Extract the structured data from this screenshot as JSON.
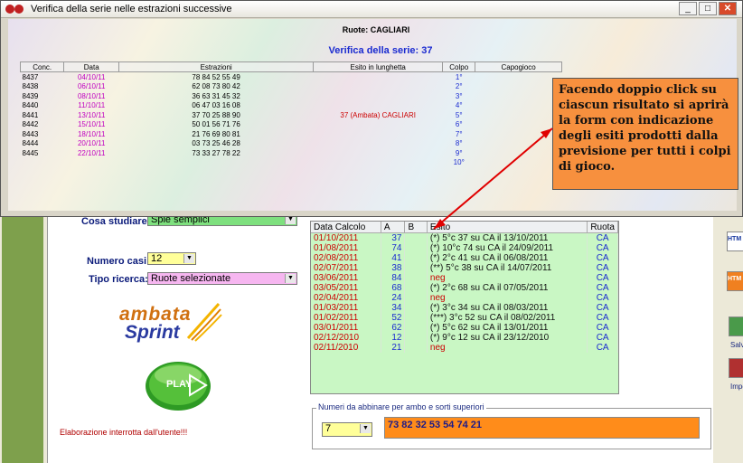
{
  "dialog": {
    "title": "Verifica della serie nelle estrazioni successive",
    "ruote": "Ruote: CAGLIARI",
    "verifica": "Verifica della serie: 37",
    "columns": [
      "Conc.",
      "Data",
      "Estrazioni",
      "Esito in lunghetta",
      "Colpo",
      "Capogioco"
    ],
    "rows": [
      {
        "conc": "8437",
        "data": "04/10/11",
        "estr": "78 84 52 55 49",
        "esito": "",
        "colpo": "1°"
      },
      {
        "conc": "8438",
        "data": "06/10/11",
        "estr": "62 08 73 80 42",
        "esito": "",
        "colpo": "2°"
      },
      {
        "conc": "8439",
        "data": "08/10/11",
        "estr": "36 63 31 45 32",
        "esito": "",
        "colpo": "3°"
      },
      {
        "conc": "8440",
        "data": "11/10/11",
        "estr": "06 47 03 16 08",
        "esito": "",
        "colpo": "4°"
      },
      {
        "conc": "8441",
        "data": "13/10/11",
        "estr": "37 70 25 88 90",
        "esito": "37   (Ambata) CAGLIARI",
        "colpo": "5°"
      },
      {
        "conc": "8442",
        "data": "15/10/11",
        "estr": "50 01 56 71 76",
        "esito": "",
        "colpo": "6°"
      },
      {
        "conc": "8443",
        "data": "18/10/11",
        "estr": "21 76 69 80 81",
        "esito": "",
        "colpo": "7°"
      },
      {
        "conc": "8444",
        "data": "20/10/11",
        "estr": "03 73 25 46 28",
        "esito": "",
        "colpo": "8°"
      },
      {
        "conc": "8445",
        "data": "22/10/11",
        "estr": "73 33 27 78 22",
        "esito": "",
        "colpo": "9°"
      },
      {
        "conc": "",
        "data": "",
        "estr": "",
        "esito": "",
        "colpo": "10°"
      }
    ]
  },
  "callout": "Facendo doppio click su ciascun risultato si aprirà la form con indicazione degli esiti prodotti dalla previsione per tutti i colpi di gioco.",
  "form": {
    "cosa_label": "Cosa studiare:",
    "cosa_value": "Spie semplici",
    "numero_label": "Numero casi:",
    "numero_value": "12",
    "tipo_label": "Tipo ricerca:",
    "tipo_value": "Ruote selezionate",
    "logo_line1": "ambata",
    "logo_line2": "Sprint",
    "play_label": "PLAY",
    "status": "Elaborazione interrotta dall'utente!!!"
  },
  "grid": {
    "columns": [
      "Data Calcolo",
      "A",
      "B",
      "Esito",
      "Ruota"
    ],
    "rows": [
      {
        "data": "01/10/2011",
        "a": "37",
        "b": "",
        "esito": "(*) 5°c 37 su CA il 13/10/2011",
        "ruota": "CA",
        "neg": false
      },
      {
        "data": "01/08/2011",
        "a": "74",
        "b": "",
        "esito": "(*) 10°c 74 su CA il 24/09/2011",
        "ruota": "CA",
        "neg": false
      },
      {
        "data": "02/08/2011",
        "a": "41",
        "b": "",
        "esito": "(*) 2°c 41 su CA il 06/08/2011",
        "ruota": "CA",
        "neg": false
      },
      {
        "data": "02/07/2011",
        "a": "38",
        "b": "",
        "esito": "(**) 5°c 38 su CA il 14/07/2011",
        "ruota": "CA",
        "neg": false
      },
      {
        "data": "03/06/2011",
        "a": "84",
        "b": "",
        "esito": "neg",
        "ruota": "CA",
        "neg": true
      },
      {
        "data": "03/05/2011",
        "a": "68",
        "b": "",
        "esito": "(*) 2°c 68 su CA il 07/05/2011",
        "ruota": "CA",
        "neg": false
      },
      {
        "data": "02/04/2011",
        "a": "24",
        "b": "",
        "esito": "neg",
        "ruota": "CA",
        "neg": true
      },
      {
        "data": "01/03/2011",
        "a": "34",
        "b": "",
        "esito": "(*) 3°c 34 su CA il 08/03/2011",
        "ruota": "CA",
        "neg": false
      },
      {
        "data": "01/02/2011",
        "a": "52",
        "b": "",
        "esito": "(***) 3°c 52 su CA il 08/02/2011",
        "ruota": "CA",
        "neg": false
      },
      {
        "data": "03/01/2011",
        "a": "62",
        "b": "",
        "esito": "(*) 5°c 62 su CA il 13/01/2011",
        "ruota": "CA",
        "neg": false
      },
      {
        "data": "02/12/2010",
        "a": "12",
        "b": "",
        "esito": "(*) 9°c 12 su CA il 23/12/2010",
        "ruota": "CA",
        "neg": false
      },
      {
        "data": "02/11/2010",
        "a": "21",
        "b": "",
        "esito": "neg",
        "ruota": "CA",
        "neg": true
      }
    ]
  },
  "abbinare": {
    "legend": "Numeri da abbinare per ambo e sorti superiori",
    "count": "7",
    "numbers": "73 82 32 53 54 74 21"
  },
  "side": {
    "htm1": "HTM",
    "htm2": "HTM",
    "salva": "Salv",
    "impo": "Impo"
  },
  "colors": {
    "callout": "#f7903e",
    "grid_bg": "#c9f7c4",
    "orange_box": "#ff8c1a",
    "arrow": "#e00000"
  }
}
